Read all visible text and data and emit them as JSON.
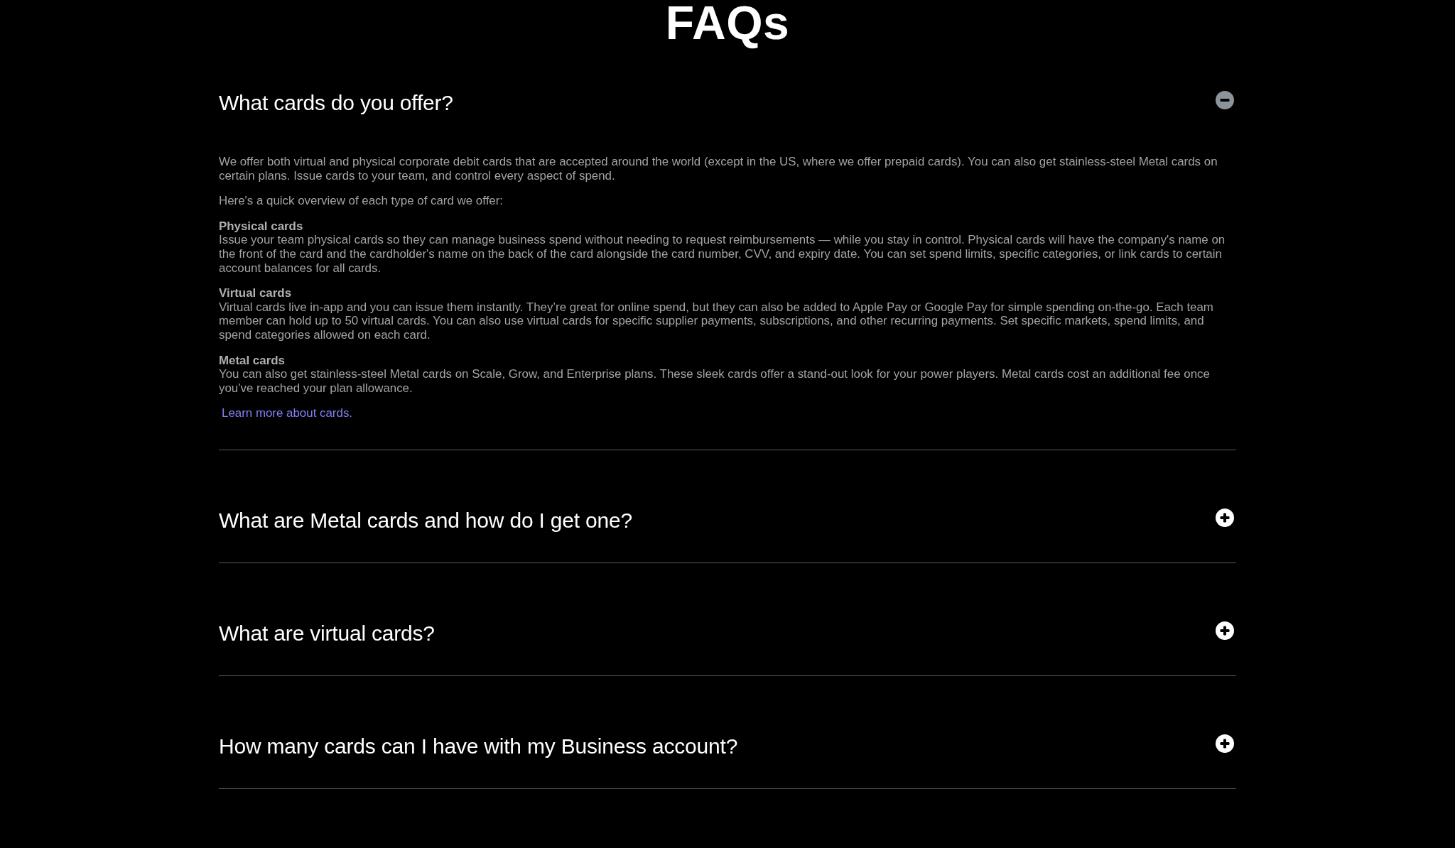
{
  "title": "FAQs",
  "faqs": [
    {
      "question": "What cards do you offer?",
      "expanded": true,
      "answer": [
        {
          "kind": "paragraph",
          "text": "We offer both virtual and physical corporate debit cards that are accepted around the world (except in the US, where we offer prepaid cards). You can also get stainless-steel Metal cards on certain plans. Issue cards to your team, and control every aspect of spend."
        },
        {
          "kind": "paragraph",
          "text": "Here's a quick overview of each type of card we offer:"
        },
        {
          "kind": "section",
          "heading": "Physical cards",
          "text": "Issue your team physical cards so they can manage business spend without needing to request reimbursements — while you stay in control. Physical cards will have the company's name on the front of the card and the cardholder's name on the back of the card alongside the card number, CVV, and expiry date. You can set spend limits, specific categories, or link cards to certain account balances for all cards."
        },
        {
          "kind": "section",
          "heading": "Virtual cards",
          "text": "Virtual cards live in-app and you can issue them instantly. They’re great for online spend, but they can also be added to Apple Pay or Google Pay for simple spending on-the-go. Each team member can hold up to 50 virtual cards. You can also use virtual cards for specific supplier payments, subscriptions, and other recurring payments. Set specific markets, spend limits, and spend categories allowed on each card."
        },
        {
          "kind": "section",
          "heading": "Metal cards",
          "text": "You can also get stainless-steel Metal cards on Scale, Grow, and Enterprise plans. These sleek cards offer a stand-out look for your power players. Metal cards cost an additional fee once you've reached your plan allowance."
        },
        {
          "kind": "link",
          "text": "Learn more about cards."
        }
      ]
    },
    {
      "question": "What are Metal cards and how do I get one?",
      "expanded": false
    },
    {
      "question": "What are virtual cards?",
      "expanded": false
    },
    {
      "question": "How many cards can I have with my Business account?",
      "expanded": false
    }
  ]
}
